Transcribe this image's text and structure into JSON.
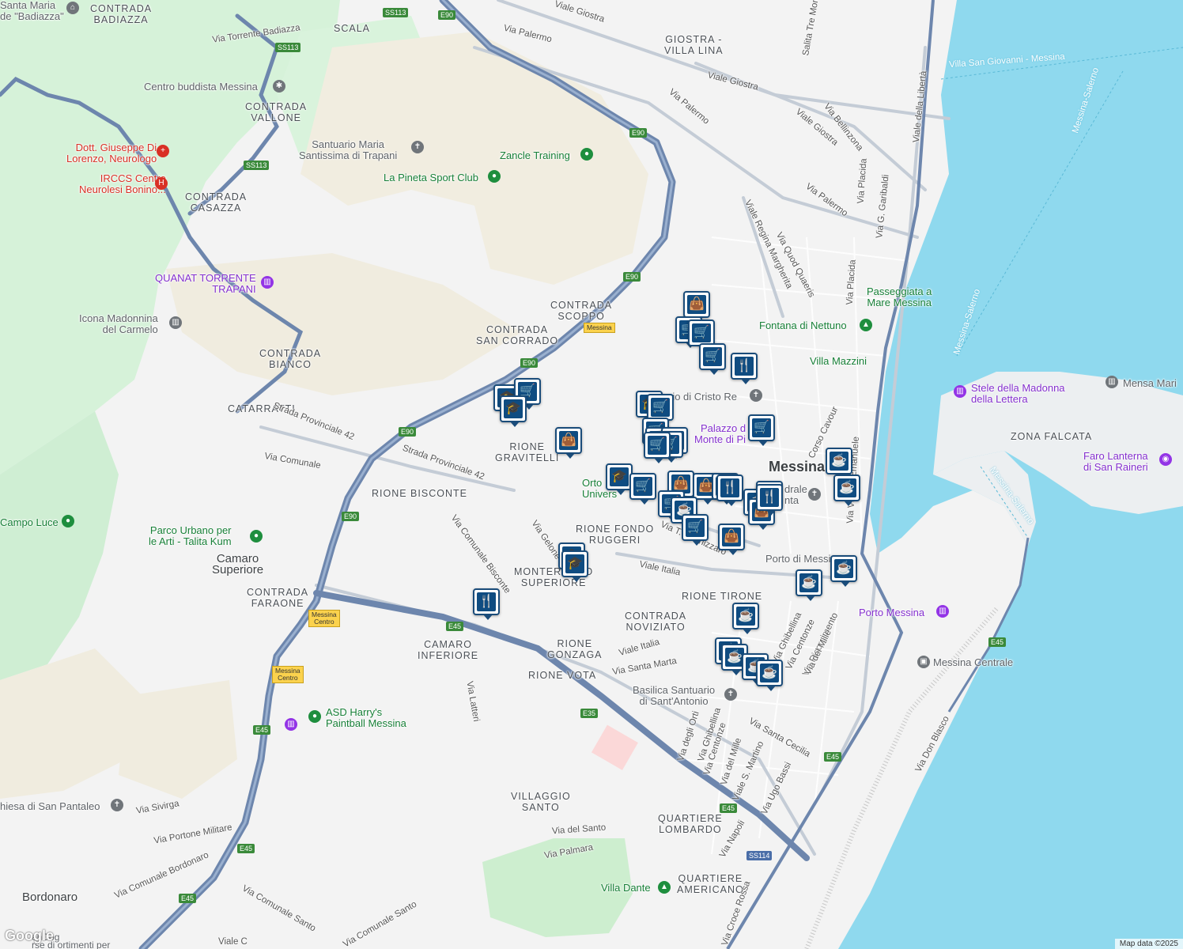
{
  "areas": [
    {
      "id": "contrada-badiazza",
      "text": "CONTRADA\nBADIAZZA"
    },
    {
      "id": "scala",
      "text": "SCALA"
    },
    {
      "id": "giostra-villa-lina",
      "text": "GIOSTRA -\nVILLA LINA"
    },
    {
      "id": "contrada-vallone",
      "text": "CONTRADA\nVALLONE"
    },
    {
      "id": "contrada-casazza",
      "text": "CONTRADA\nCASAZZA"
    },
    {
      "id": "contrada-scoppo",
      "text": "CONTRADA\nSCOPPO"
    },
    {
      "id": "contrada-san-corrado",
      "text": "CONTRADA\nSAN CORRADO"
    },
    {
      "id": "contrada-bianco",
      "text": "CONTRADA\nBIANCO"
    },
    {
      "id": "catarratti",
      "text": "CATARRATTI"
    },
    {
      "id": "rione-gravitelli",
      "text": "RIONE\nGRAVITELLI"
    },
    {
      "id": "rione-bisconte",
      "text": "RIONE BISCONTE"
    },
    {
      "id": "rione-fondo-ruggeri",
      "text": "RIONE FONDO\nRUGGERI"
    },
    {
      "id": "monteroso-superiore",
      "text": "MONTEROSSO\nSUPERIORE"
    },
    {
      "id": "contrada-faraone",
      "text": "CONTRADA\nFARAONE"
    },
    {
      "id": "rione-tirone",
      "text": "RIONE TIRONE"
    },
    {
      "id": "contrada-noviziato",
      "text": "CONTRADA\nNOVIZIATO"
    },
    {
      "id": "camaro-inferiore",
      "text": "CAMARO\nINFERIORE"
    },
    {
      "id": "rione-gonzaga",
      "text": "RIONE\nGONZAGA"
    },
    {
      "id": "rione-vota",
      "text": "RIONE VOTA"
    },
    {
      "id": "villaggio-santo",
      "text": "VILLAGGIO\nSANTO"
    },
    {
      "id": "quartiere-lombardo",
      "text": "QUARTIERE\nLOMBARDO"
    },
    {
      "id": "quartiere-americano",
      "text": "QUARTIERE\nAMERICANO"
    },
    {
      "id": "zona-falcata",
      "text": "ZONA FALCATA"
    }
  ],
  "towns": [
    {
      "id": "messina",
      "text": "Messina"
    },
    {
      "id": "camaro-superiore",
      "text": "Camaro\nSuperiore"
    },
    {
      "id": "bordonaro",
      "text": "Bordonaro"
    }
  ],
  "streets": [
    {
      "id": "viale-giostra-1",
      "text": "Viale Giostra"
    },
    {
      "id": "via-palermo-1",
      "text": "Via Palermo"
    },
    {
      "id": "via-torrente-badiazza",
      "text": "Via Torrente Badiazza"
    },
    {
      "id": "viale-giostra-2",
      "text": "Viale Giostra"
    },
    {
      "id": "via-palermo-2",
      "text": "Via Palermo"
    },
    {
      "id": "viale-giostra-3",
      "text": "Viale Giostra"
    },
    {
      "id": "via-bellinzona",
      "text": "Via Bellinzona"
    },
    {
      "id": "via-palermo-3",
      "text": "Via Palermo"
    },
    {
      "id": "viale-regina-margherita",
      "text": "Viale Regina Margherita"
    },
    {
      "id": "via-quod-quaeris",
      "text": "Via Quod Quaeris"
    },
    {
      "id": "via-placida-1",
      "text": "Via Placida"
    },
    {
      "id": "via-placida-2",
      "text": "Via Placida"
    },
    {
      "id": "via-g-garibaldi",
      "text": "Via G. Garibaldi"
    },
    {
      "id": "viale-della-liberta",
      "text": "Viale della Libertà"
    },
    {
      "id": "salita-tre-monti",
      "text": "Salita Tre Monti"
    },
    {
      "id": "strada-provinciale-42-a",
      "text": "Strada Provinciale 42"
    },
    {
      "id": "strada-provinciale-42-b",
      "text": "Strada Provinciale 42"
    },
    {
      "id": "via-comunale",
      "text": "Via Comunale"
    },
    {
      "id": "via-comunale-bisconte",
      "text": "Via Comunale Bisconte"
    },
    {
      "id": "via-gelone",
      "text": "Via Gelone"
    },
    {
      "id": "viale-italia-1",
      "text": "Viale Italia"
    },
    {
      "id": "viale-italia-2",
      "text": "Viale Italia"
    },
    {
      "id": "via-tommaso-cannizzaro",
      "text": "Via T. Cannizzaro"
    },
    {
      "id": "corso-cavour",
      "text": "Corso Cavour"
    },
    {
      "id": "via-vittorio-emanuele",
      "text": "Via Vittorio Emanuele"
    },
    {
      "id": "via-santa-marta",
      "text": "Via Santa Marta"
    },
    {
      "id": "via-latteri",
      "text": "Via Latteri"
    },
    {
      "id": "via-ghibellina-1",
      "text": "Via Ghibellina"
    },
    {
      "id": "via-centonze-1",
      "text": "Via Centonze"
    },
    {
      "id": "via-risorgimento",
      "text": "Via Risorgimento"
    },
    {
      "id": "via-del-mille-1",
      "text": "Via del Mille"
    },
    {
      "id": "via-degli-orti",
      "text": "Via degli Orti"
    },
    {
      "id": "via-ghibellina-2",
      "text": "Via Ghibellina"
    },
    {
      "id": "via-centonze-2",
      "text": "Via Centonze"
    },
    {
      "id": "via-del-mille-2",
      "text": "Via del Mille"
    },
    {
      "id": "viale-s-martino",
      "text": "Viale S. Martino"
    },
    {
      "id": "via-santa-cecilia",
      "text": "Via Santa Cecilia"
    },
    {
      "id": "via-ugo-bassi",
      "text": "Via Ugo Bassi"
    },
    {
      "id": "via-napoli",
      "text": "Via Napoli"
    },
    {
      "id": "via-don-blasco",
      "text": "Via Don Blasco"
    },
    {
      "id": "via-del-santo",
      "text": "Via del Santo"
    },
    {
      "id": "via-palmara",
      "text": "Via Palmara"
    },
    {
      "id": "via-sivirga",
      "text": "Via Sivirga"
    },
    {
      "id": "via-portone-militare",
      "text": "Via Portone Militare"
    },
    {
      "id": "via-comunale-bordonaro",
      "text": "Via Comunale Bordonaro"
    },
    {
      "id": "via-comunale-santo-1",
      "text": "Via Comunale Santo"
    },
    {
      "id": "via-comunale-santo-2",
      "text": "Via Comunale Santo"
    },
    {
      "id": "via-croce-rossa",
      "text": "Via Croce Rossa"
    },
    {
      "id": "viale-c",
      "text": "Viale C"
    },
    {
      "id": "villa-san-giovanni-messina",
      "text": "Villa San Giovanni - Messina"
    },
    {
      "id": "messina-salerno-1",
      "text": "Messina-Salerno"
    },
    {
      "id": "messina-salerno-2",
      "text": "Messina-Salerno"
    },
    {
      "id": "messina-salerno-3",
      "text": "Messina-Salerno"
    }
  ],
  "pois": [
    {
      "id": "santa-maria-badiazza",
      "text": "Santa Maria\nde \"Badiazza\"",
      "kind": "gray"
    },
    {
      "id": "centro-buddista",
      "text": "Centro buddista Messina",
      "kind": "gray"
    },
    {
      "id": "dott-giuseppe",
      "text": "Dott. Giuseppe Di\nLorenzo, Neurologo",
      "kind": "red"
    },
    {
      "id": "irccs",
      "text": "IRCCS Centro\nNeurolesi Bonino...",
      "kind": "red"
    },
    {
      "id": "santuario-trapani",
      "text": "Santuario Maria\nSantissima di Trapani",
      "kind": "gray"
    },
    {
      "id": "zancle-training",
      "text": "Zancle Training",
      "kind": "green"
    },
    {
      "id": "la-pineta",
      "text": "La Pineta Sport Club",
      "kind": "green"
    },
    {
      "id": "quanat",
      "text": "QUANAT TORRENTE\nTRAPANI",
      "kind": "purple"
    },
    {
      "id": "icona-madonnina",
      "text": "Icona Madonnina\ndel Carmelo",
      "kind": "gray"
    },
    {
      "id": "passeggiata",
      "text": "Passeggiata a\nMare Messina",
      "kind": "green"
    },
    {
      "id": "fontana-nettuno",
      "text": "Fontana di Nettuno",
      "kind": "green"
    },
    {
      "id": "villa-mazzini",
      "text": "Villa Mazzini",
      "kind": "green"
    },
    {
      "id": "cristo-re",
      "text": "rio di Cristo Re",
      "kind": "gray"
    },
    {
      "id": "palazzo-monte-pieta",
      "text": "Palazzo d\nMonte di Pi",
      "kind": "purple"
    },
    {
      "id": "stele-madonna",
      "text": "Stele della Madonna\ndella Lettera",
      "kind": "purple"
    },
    {
      "id": "mensa-mari",
      "text": "Mensa Mari",
      "kind": "gray"
    },
    {
      "id": "faro-lanterna",
      "text": "Faro Lanterna\ndi San Raineri",
      "kind": "purple"
    },
    {
      "id": "orto-botanico",
      "text": "Orto\nUnivers",
      "kind": "green"
    },
    {
      "id": "cattedrale",
      "text": "drale\nnta",
      "kind": "gray"
    },
    {
      "id": "porto-messina-text",
      "text": "Porto di Messi",
      "kind": "gray"
    },
    {
      "id": "porto-messina",
      "text": "Porto Messina",
      "kind": "purple"
    },
    {
      "id": "messina-centrale",
      "text": "Messina Centrale",
      "kind": "gray"
    },
    {
      "id": "campo-luce",
      "text": "Campo Luce",
      "kind": "green"
    },
    {
      "id": "parco-talita",
      "text": "Parco Urbano per\nle Arti - Talita Kum",
      "kind": "green"
    },
    {
      "id": "basilica-antonio",
      "text": "Basilica Santuario\ndi Sant'Antonio",
      "kind": "gray"
    },
    {
      "id": "asd-harry",
      "text": "ASD Harry's\nPaintball Messina",
      "kind": "green"
    },
    {
      "id": "chiesa-pantaleo",
      "text": "hiesa di San Pantaleo",
      "kind": "gray"
    },
    {
      "id": "villa-dante",
      "text": "Villa Dante",
      "kind": "green"
    },
    {
      "id": "camper-dog",
      "text": "enDog\nrse di ortimenti per",
      "kind": "gray"
    }
  ],
  "shields": [
    "SS113",
    "E90",
    "SS113",
    "SS113",
    "E90",
    "E90",
    "E90",
    "E90",
    "E90",
    "E45",
    "E45",
    "E45",
    "E45",
    "E45",
    "E45",
    "E35",
    "SS114",
    "E45"
  ],
  "stations": [
    "Messina",
    "Messina\nCentro",
    "Messina\nCentro"
  ],
  "markers": [
    {
      "id": "m1",
      "icon": "shopping-bag-icon"
    },
    {
      "id": "m2",
      "icon": "cart-icon"
    },
    {
      "id": "m3",
      "icon": "cart-icon"
    },
    {
      "id": "m4",
      "icon": "cart-icon"
    },
    {
      "id": "m5",
      "icon": "restaurant-icon"
    },
    {
      "id": "m6",
      "icon": "school-icon"
    },
    {
      "id": "m7",
      "icon": "cart-icon"
    },
    {
      "id": "m8",
      "icon": "school-icon"
    },
    {
      "id": "m9",
      "icon": "cart-icon"
    },
    {
      "id": "m10",
      "icon": "school-icon"
    },
    {
      "id": "m11",
      "icon": "cart-icon"
    },
    {
      "id": "m12",
      "icon": "shopping-bag-icon"
    },
    {
      "id": "m13",
      "icon": "cart-icon"
    },
    {
      "id": "m14",
      "icon": "school-icon"
    },
    {
      "id": "m15",
      "icon": "cart-icon"
    },
    {
      "id": "m16",
      "icon": "cart-icon"
    },
    {
      "id": "m17",
      "icon": "cart-icon"
    },
    {
      "id": "m18",
      "icon": "school-icon"
    },
    {
      "id": "m19",
      "icon": "cart-icon"
    },
    {
      "id": "m20",
      "icon": "shopping-bag-icon"
    },
    {
      "id": "m21",
      "icon": "shopping-bag-icon"
    },
    {
      "id": "m22",
      "icon": "restaurant-icon"
    },
    {
      "id": "m23",
      "icon": "restaurant-icon"
    },
    {
      "id": "m24",
      "icon": "coffee-icon"
    },
    {
      "id": "m25",
      "icon": "coffee-icon"
    },
    {
      "id": "m26",
      "icon": "cart-icon"
    },
    {
      "id": "m27",
      "icon": "shopping-bag-icon"
    },
    {
      "id": "m28",
      "icon": "coffee-icon"
    },
    {
      "id": "m29",
      "icon": "cart-icon"
    },
    {
      "id": "m30",
      "icon": "shopping-bag-icon"
    },
    {
      "id": "m31",
      "icon": "coffee-icon"
    },
    {
      "id": "m32",
      "icon": "coffee-icon"
    },
    {
      "id": "m33",
      "icon": "coffee-icon"
    },
    {
      "id": "m34",
      "icon": "school-icon"
    },
    {
      "id": "m35",
      "icon": "school-icon"
    },
    {
      "id": "m36",
      "icon": "restaurant-icon"
    },
    {
      "id": "m37",
      "icon": "coffee-icon"
    },
    {
      "id": "m38",
      "icon": "coffee-icon"
    },
    {
      "id": "m39",
      "icon": "coffee-icon"
    },
    {
      "id": "m40",
      "icon": "coffee-icon"
    },
    {
      "id": "m41",
      "icon": "coffee-icon"
    },
    {
      "id": "m42",
      "icon": "restaurant-icon"
    },
    {
      "id": "m43",
      "icon": "coffee-icon"
    }
  ],
  "attribution": "Map data ©2025",
  "logo": "Google",
  "colors": {
    "sea": "#8fd9ee",
    "land": "#f3f3f3",
    "park": "#d6f2d9",
    "highway": "#6d86ad",
    "marker": "#0f4c81"
  }
}
